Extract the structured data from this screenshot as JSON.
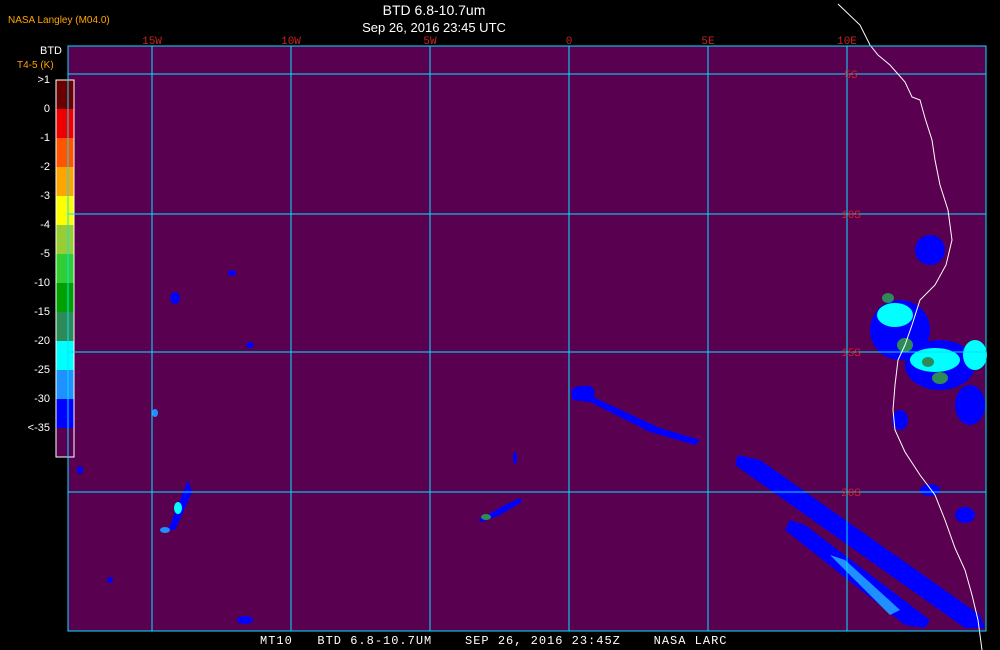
{
  "header": {
    "org": "NASA Langley (M04.0)",
    "title": "BTD 6.8-10.7um",
    "subtitle": "Sep 26, 2016 23:45 UTC"
  },
  "colorbar": {
    "title_line1": "BTD",
    "title_line2": "T4-5 (K)",
    "levels": [
      {
        "label": ">1",
        "color": "#6b0000"
      },
      {
        "label": "0",
        "color": "#ee0000"
      },
      {
        "label": "-1",
        "color": "#ff5500"
      },
      {
        "label": "-2",
        "color": "#ffa500"
      },
      {
        "label": "-3",
        "color": "#ffff00"
      },
      {
        "label": "-4",
        "color": "#9acd32"
      },
      {
        "label": "-5",
        "color": "#32cd32"
      },
      {
        "label": "-10",
        "color": "#00a000"
      },
      {
        "label": "-15",
        "color": "#2e8b57"
      },
      {
        "label": "-20",
        "color": "#00ffff"
      },
      {
        "label": "-25",
        "color": "#1e90ff"
      },
      {
        "label": "-30",
        "color": "#0000ff"
      },
      {
        "label": "<-35",
        "color": "#5a0050"
      }
    ]
  },
  "map": {
    "lon_labels": [
      "15W",
      "10W",
      "5W",
      "0",
      "5E",
      "10E"
    ],
    "lat_labels": [
      "5S",
      "10S",
      "15S",
      "20S"
    ],
    "background_color": "#5a0050",
    "grid_color": "#00e5ff"
  },
  "footer": {
    "text": "MT10   BTD 6.8-10.7UM    SEP 26, 2016 23:45Z    NASA LARC"
  }
}
